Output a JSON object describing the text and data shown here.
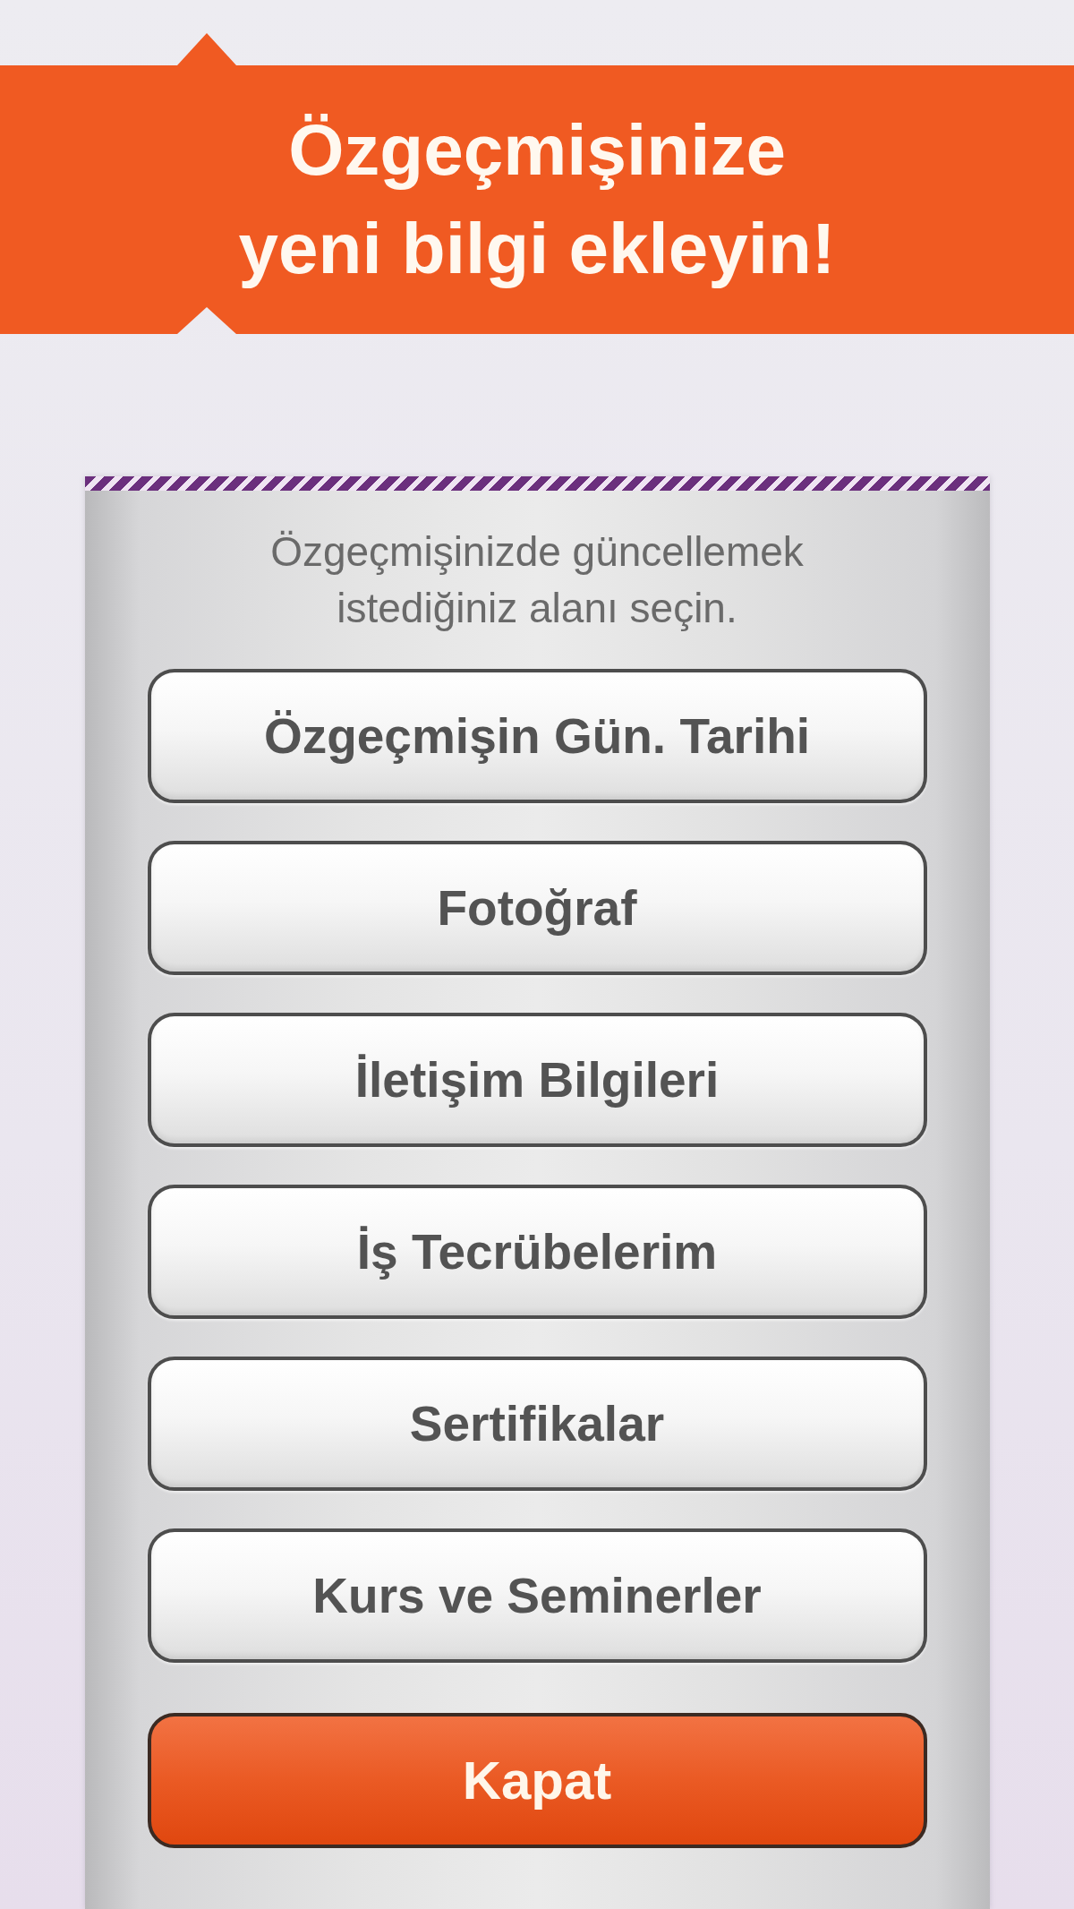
{
  "banner": {
    "title": "Özgeçmişinize yeni bilgi ekleyin!"
  },
  "dialog": {
    "instruction": "Özgeçmişinizde güncellemek istediğiniz alanı seçin.",
    "options": [
      {
        "label": "Özgeçmişin Gün. Tarihi"
      },
      {
        "label": "Fotoğraf"
      },
      {
        "label": "İletişim Bilgileri"
      },
      {
        "label": "İş Tecrübelerim"
      },
      {
        "label": "Sertifikalar"
      },
      {
        "label": "Kurs ve Seminerler"
      }
    ],
    "close_button": {
      "label": "Kapat"
    }
  }
}
